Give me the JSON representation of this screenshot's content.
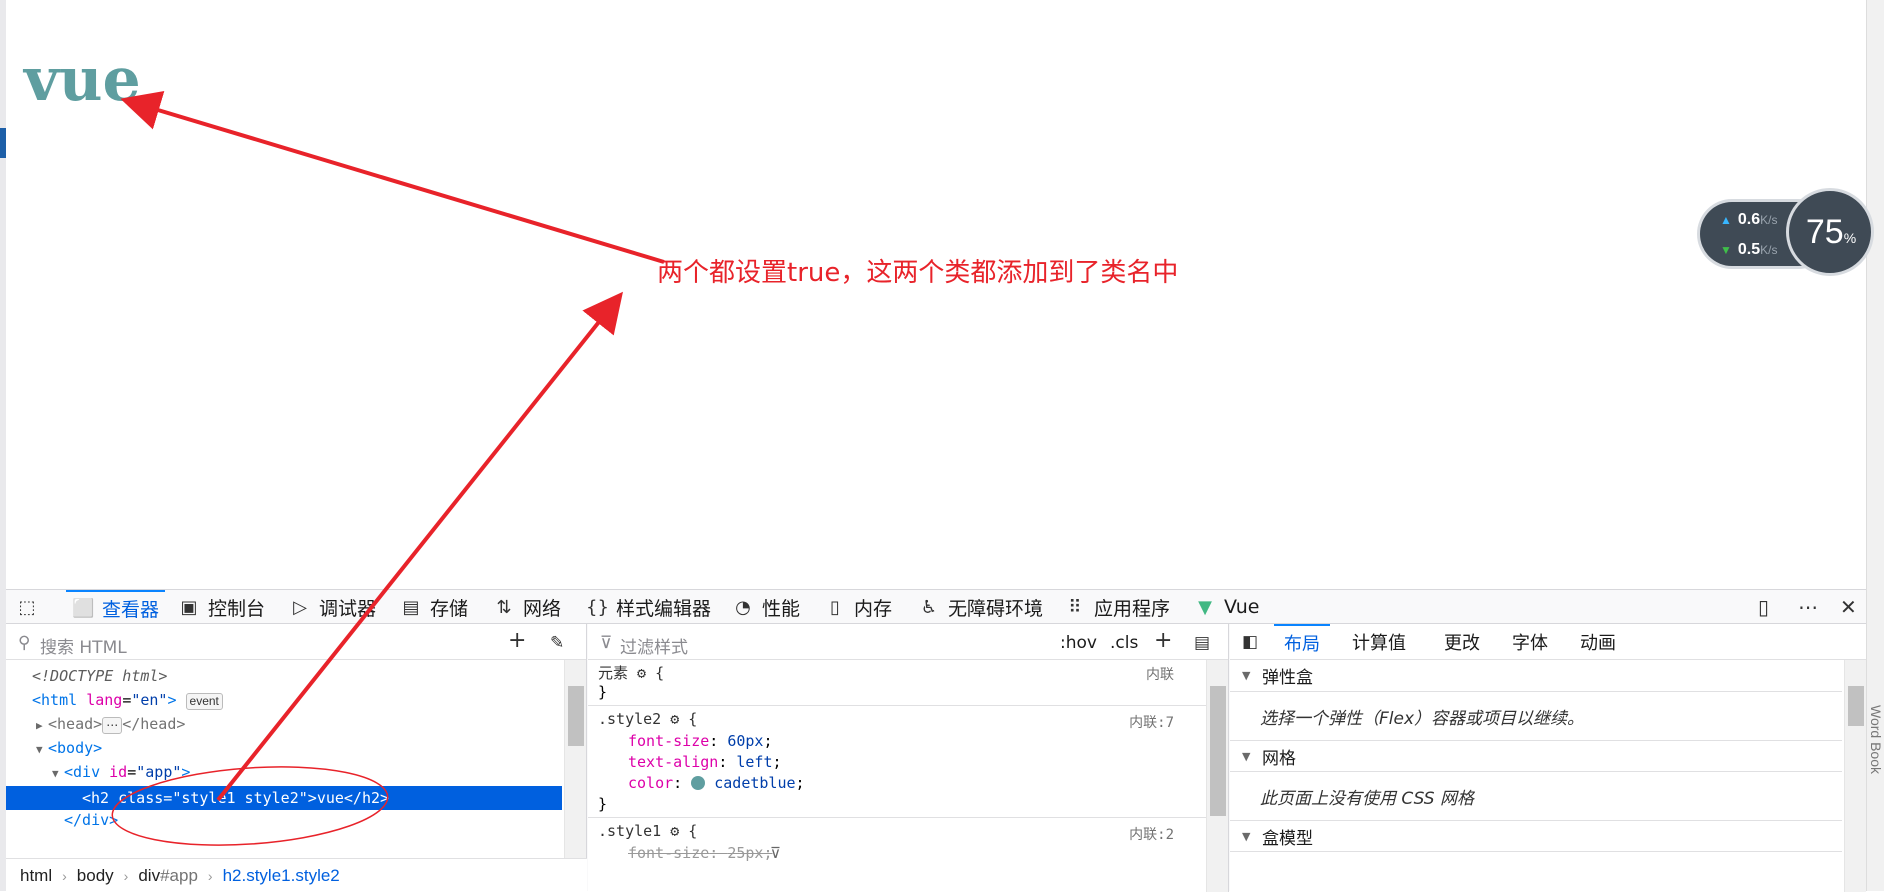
{
  "page": {
    "heading": "vue"
  },
  "annotation": {
    "text": "两个都设置true，这两个类都添加到了类名中",
    "color": "#e8232a"
  },
  "net_widget": {
    "up_value": "0.6",
    "up_unit": "K/s",
    "down_value": "0.5",
    "down_unit": "K/s",
    "gauge_value": "75",
    "gauge_unit": "%"
  },
  "devtools": {
    "toolbar": {
      "tools": [
        {
          "label": "查看器",
          "icon": "inspector-icon"
        },
        {
          "label": "控制台",
          "icon": "console-icon"
        },
        {
          "label": "调试器",
          "icon": "debugger-icon"
        },
        {
          "label": "存储",
          "icon": "storage-icon"
        },
        {
          "label": "网络",
          "icon": "network-icon"
        },
        {
          "label": "样式编辑器",
          "icon": "style-editor-icon"
        },
        {
          "label": "性能",
          "icon": "performance-icon"
        },
        {
          "label": "内存",
          "icon": "memory-icon"
        },
        {
          "label": "无障碍环境",
          "icon": "accessibility-icon"
        },
        {
          "label": "应用程序",
          "icon": "application-icon"
        },
        {
          "label": "Vue",
          "icon": "vue-icon"
        }
      ]
    },
    "html_panel": {
      "search_placeholder": "搜索 HTML",
      "doctype": "<!DOCTYPE html>",
      "html_tag_open": "<html",
      "html_lang_attr": "lang",
      "html_lang_val": "\"en\"",
      "event_badge": "event",
      "head_open": "<head>",
      "head_badge": "⋯",
      "head_close": "</head>",
      "body_open": "<body>",
      "div_open": "<div",
      "div_id_attr": "id",
      "div_id_val": "\"app\"",
      "h2_open": "<h2",
      "h2_class_attr": "class",
      "h2_class_val": "\"style1 style2\"",
      "h2_text": "vue",
      "h2_close": "</h2>",
      "div_close": "</div>",
      "breadcrumbs": [
        "html",
        "body",
        "div",
        "#app",
        "h2.style1.style2"
      ]
    },
    "rules_panel": {
      "filter_placeholder": "过滤样式",
      "hov": ":hov",
      "cls": ".cls",
      "element_rule": {
        "selector": "元素",
        "source": "内联"
      },
      "style2_rule": {
        "selector": ".style2",
        "source": "内联:7",
        "props": [
          {
            "name": "font-size",
            "value": "60px"
          },
          {
            "name": "text-align",
            "value": "left"
          },
          {
            "name": "color",
            "value": "cadetblue"
          }
        ]
      },
      "style1_rule": {
        "selector": ".style1",
        "source": "内联:2",
        "props": [
          {
            "name": "font-size",
            "value": "25px"
          }
        ]
      }
    },
    "layout_panel": {
      "tabs": [
        "布局",
        "计算值",
        "更改",
        "字体",
        "动画"
      ],
      "flexbox_title": "弹性盒",
      "flexbox_msg": "选择一个弹性（Flex）容器或项目以继续。",
      "grid_title": "网格",
      "grid_msg": "此页面上没有使用 CSS 网格",
      "boxmodel_title": "盒模型"
    }
  },
  "colors": {
    "heading": "#5f9ea0",
    "accent": "#0060df",
    "annotation": "#e8232a"
  }
}
